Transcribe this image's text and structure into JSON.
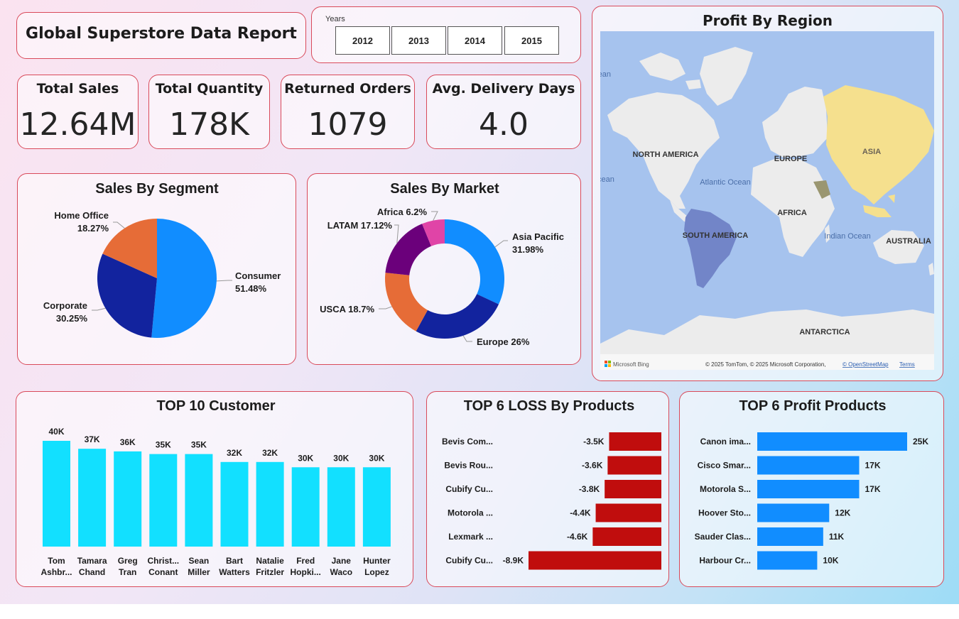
{
  "report_title": "Global Superstore Data Report",
  "years_filter": {
    "label": "Years",
    "options": [
      "2012",
      "2013",
      "2014",
      "2015"
    ]
  },
  "kpis": [
    {
      "label": "Total Sales",
      "value": "12.64M"
    },
    {
      "label": "Total Quantity",
      "value": "178K"
    },
    {
      "label": "Returned Orders",
      "value": "1079"
    },
    {
      "label": "Avg. Delivery Days",
      "value": "4.0"
    }
  ],
  "map": {
    "title": "Profit By Region",
    "regions": [
      "NORTH AMERICA",
      "EUROPE",
      "ASIA",
      "AFRICA",
      "SOUTH AMERICA",
      "AUSTRALIA",
      "ANTARCTICA"
    ],
    "oceans": [
      "Atlantic Ocean",
      "Indian Ocean",
      "Pacific Ocean",
      "Arctic Ocean"
    ],
    "attribution": "© 2025 TomTom, © 2025 Microsoft Corporation,",
    "osm_link": "© OpenStreetMap",
    "terms_link": "Terms",
    "bing_logo": "Microsoft Bing",
    "colors": {
      "water": "#a6c3ee",
      "land": "#ececec",
      "asia": "#f5e08e",
      "south_america": "#7285c8"
    }
  },
  "chart_data": [
    {
      "type": "pie",
      "title": "Sales By Segment",
      "labels": [
        "Consumer",
        "Corporate",
        "Home Office"
      ],
      "values": [
        51.48,
        30.25,
        18.27
      ],
      "value_labels": [
        "51.48%",
        "30.25%",
        "18.27%"
      ],
      "colors": [
        "#118dff",
        "#12239e",
        "#e66c37"
      ]
    },
    {
      "type": "pie",
      "title": "Sales By Market",
      "donut": true,
      "labels": [
        "Asia Pacific",
        "Europe",
        "USCA",
        "LATAM",
        "Africa"
      ],
      "values": [
        31.98,
        26,
        18.7,
        17.12,
        6.2
      ],
      "point_labels": [
        "Asia Pacific 31.98%",
        "Europe 26%",
        "USCA 18.7%",
        "LATAM 17.12%",
        "Africa 6.2%"
      ],
      "colors": [
        "#118dff",
        "#12239e",
        "#e66c37",
        "#6b007b",
        "#e044a7"
      ]
    },
    {
      "type": "bar",
      "title": "TOP 10 Customer",
      "categories": [
        [
          "Tom",
          "Ashbr..."
        ],
        [
          "Tamara",
          "Chand"
        ],
        [
          "Greg",
          "Tran"
        ],
        [
          "Christ...",
          "Conant"
        ],
        [
          "Sean",
          "Miller"
        ],
        [
          "Bart",
          "Watters"
        ],
        [
          "Natalie",
          "Fritzler"
        ],
        [
          "Fred",
          "Hopki..."
        ],
        [
          "Jane",
          "Waco"
        ],
        [
          "Hunter",
          "Lopez"
        ]
      ],
      "values": [
        40,
        37,
        36,
        35,
        35,
        32,
        32,
        30,
        30,
        30
      ],
      "value_labels": [
        "40K",
        "37K",
        "36K",
        "35K",
        "35K",
        "32K",
        "32K",
        "30K",
        "30K",
        "30K"
      ],
      "color": "#12e0ff"
    },
    {
      "type": "bar",
      "orientation": "horizontal",
      "title": "TOP 6 LOSS By Products",
      "categories": [
        "Bevis Com...",
        "Bevis Rou...",
        "Cubify Cu...",
        "Motorola ...",
        "Lexmark ...",
        "Cubify Cu..."
      ],
      "values": [
        -3.5,
        -3.6,
        -3.8,
        -4.4,
        -4.6,
        -8.9
      ],
      "value_labels": [
        "-3.5K",
        "-3.6K",
        "-3.8K",
        "-4.4K",
        "-4.6K",
        "-8.9K"
      ],
      "color": "#c00d0d"
    },
    {
      "type": "bar",
      "orientation": "horizontal",
      "title": "TOP 6 Profit Products",
      "categories": [
        "Canon ima...",
        "Cisco Smar...",
        "Motorola S...",
        "Hoover Sto...",
        "Sauder Clas...",
        "Harbour Cr..."
      ],
      "values": [
        25,
        17,
        17,
        12,
        11,
        10
      ],
      "value_labels": [
        "25K",
        "17K",
        "17K",
        "12K",
        "11K",
        "10K"
      ],
      "color": "#118dff"
    }
  ]
}
